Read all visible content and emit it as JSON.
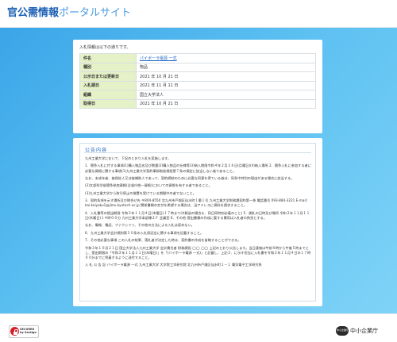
{
  "header": {
    "title_main": "官公需情報",
    "title_sub": "ポータルサイト"
  },
  "summary": {
    "intro": "入札情報は以下の通りです。",
    "rows": [
      {
        "label": "件名",
        "value": "パイポーラ電源 一式",
        "link": true
      },
      {
        "label": "種別",
        "value": "物品",
        "link": false
      },
      {
        "label": "公示日または更新日",
        "value": "2021 年 10 月 21 日",
        "link": false
      },
      {
        "label": "入札期日",
        "value": "2021 年 11 月 11 日",
        "link": false
      },
      {
        "label": "組織",
        "value": "国立大学法人",
        "link": false
      },
      {
        "label": "取得日",
        "value": "2021 年 10 月 21 日",
        "link": false
      }
    ]
  },
  "notice": {
    "title": "公告内容",
    "paragraphs": [
      "九州工業大学において、下記のとおり入札を実施します。",
      "1．競争入札に付する事項(1)購入物品名及び数量(2)購入物品の仕様等(3)納入期限令和４年２月２８日(月曜日)(4)納入場所 2．競争入札に参加する者に必要な資格に関する事項(1)九州工業大学契約事務取扱規程第７条の規定に該当しない者であること。",
      "なお、未成年者、被保佐人又は被補助人であって、契約締結のために必要な同意を得ている者は、同条中特別の理由がある場合に該当する。",
      "(2)文部科学省競争参加資格(全省庁統一資格)においての資格を有する者であること。",
      "(3)九州工業大学から取引停止の措置を受けている期間中の者でないこと。",
      "3．契約条項を示す場所及び問合せ先 〒804-8550 北九州市戸畑区仙水町１番１号 九州工業大学財務課契約第一係 電話番号 093-884-3221 E-mail：kai-keiyaku1@jimu.kyutech.ac.jp 関係書類の交付を希望する場合は、当アドレスに資料を請求すること。",
      "4．入札書等の提出期限 令和３年１１月４日(木曜日)１７時まで(※郵送の場合も、同日同時刻必着のこと) 5．開札の日時及び場所 令和３年１１月１１日(木曜日)１４時００分 九州工業大学本部棟２Ｆ 会議室 6．その他 提出書類の作成に要する費用は入札者の負担とする。",
      "なお、電報、電話、ファクシミリ、その他の方法による入札は認めない。",
      "6．九州工業大学会計規則第３０条の入札保証金に関する事項を記載すること。",
      "7．その他必要な事項 この入札の結果、落札者が決定した時は、契約書の作成を省略することができる。",
      "令和３年１０月２１日 国立大学法人九州工業大学 会計責任者 財務課長 ◯◯ ◯◯ 上記のとおり公告します。当日連絡は午前９時から午後５時までとし、提出期限の「令和３年１１月１１日(木曜日)」を「(バイポーラ電源 一式)」と記載し、上記３．に示す担当に入札書を令和３年１１月４日の１７時００分までに到着するように送付すること。",
      "入 札 公 告 記 バイポーラ電源 一式 九州工業大学 大学院工学研究院 北九州市戸畑区仙水町１－１ 電気電子工学研究系"
    ]
  },
  "footer": {
    "secured_line1": "SECURED",
    "secured_line2": "by Sectigo",
    "agency_mark": "中小企業庁",
    "agency_name": "中小企業庁"
  }
}
